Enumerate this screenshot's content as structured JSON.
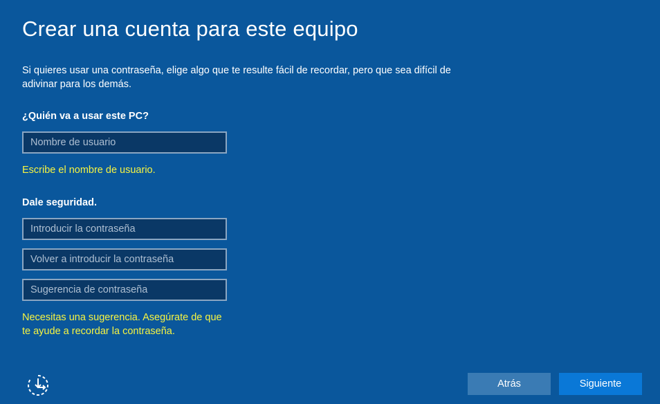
{
  "page": {
    "title": "Crear una cuenta para este equipo",
    "intro": "Si quieres usar una contraseña, elige algo que te resulte fácil de recordar, pero que sea difícil de adivinar para los demás."
  },
  "user_section": {
    "label": "¿Quién va a usar este PC?",
    "username_placeholder": "Nombre de usuario",
    "username_value": "",
    "hint": "Escribe el nombre de usuario."
  },
  "security_section": {
    "label": "Dale seguridad.",
    "password_placeholder": "Introducir la contraseña",
    "confirm_placeholder": "Volver a introducir la contraseña",
    "hint_placeholder": "Sugerencia de contraseña",
    "hint_line1": "Necesitas una sugerencia. Asegúrate de que",
    "hint_line2": "te ayude a recordar la contraseña."
  },
  "footer": {
    "accessibility_icon": "ease-of-access-icon",
    "back_label": "Atrás",
    "next_label": "Siguiente"
  },
  "colors": {
    "background": "#0a579c",
    "warning_text": "#f7f441",
    "field_background": "#0a3866",
    "next_button": "#0a78d7",
    "back_button": "#3a7bb4"
  }
}
